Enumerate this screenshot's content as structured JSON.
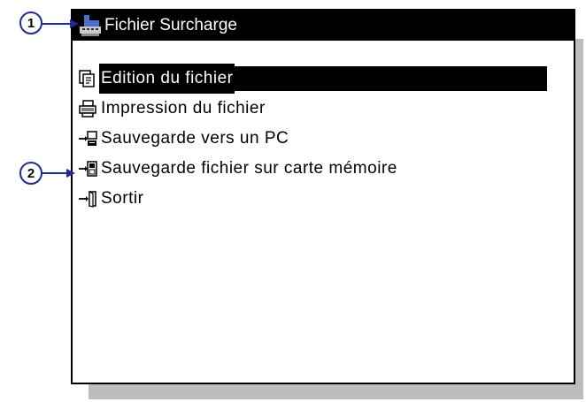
{
  "window": {
    "title": "Fichier Surcharge",
    "title_icon": "scale-icon"
  },
  "menu": {
    "items": [
      {
        "label": "Edition du fichier",
        "icon": "edit-file-icon",
        "selected": true
      },
      {
        "label": "Impression du fichier",
        "icon": "printer-icon",
        "selected": false
      },
      {
        "label": "Sauvegarde vers un PC",
        "icon": "save-to-pc-icon",
        "selected": false
      },
      {
        "label": "Sauvegarde fichier sur carte mémoire",
        "icon": "save-to-memory-card-icon",
        "selected": false
      },
      {
        "label": "Sortir",
        "icon": "exit-icon",
        "selected": false
      }
    ]
  },
  "callouts": [
    {
      "number": "1"
    },
    {
      "number": "2"
    }
  ],
  "colors": {
    "callout_blue": "#1d2aa6",
    "selection_bg": "#000000",
    "shadow": "#bdbdbd"
  }
}
